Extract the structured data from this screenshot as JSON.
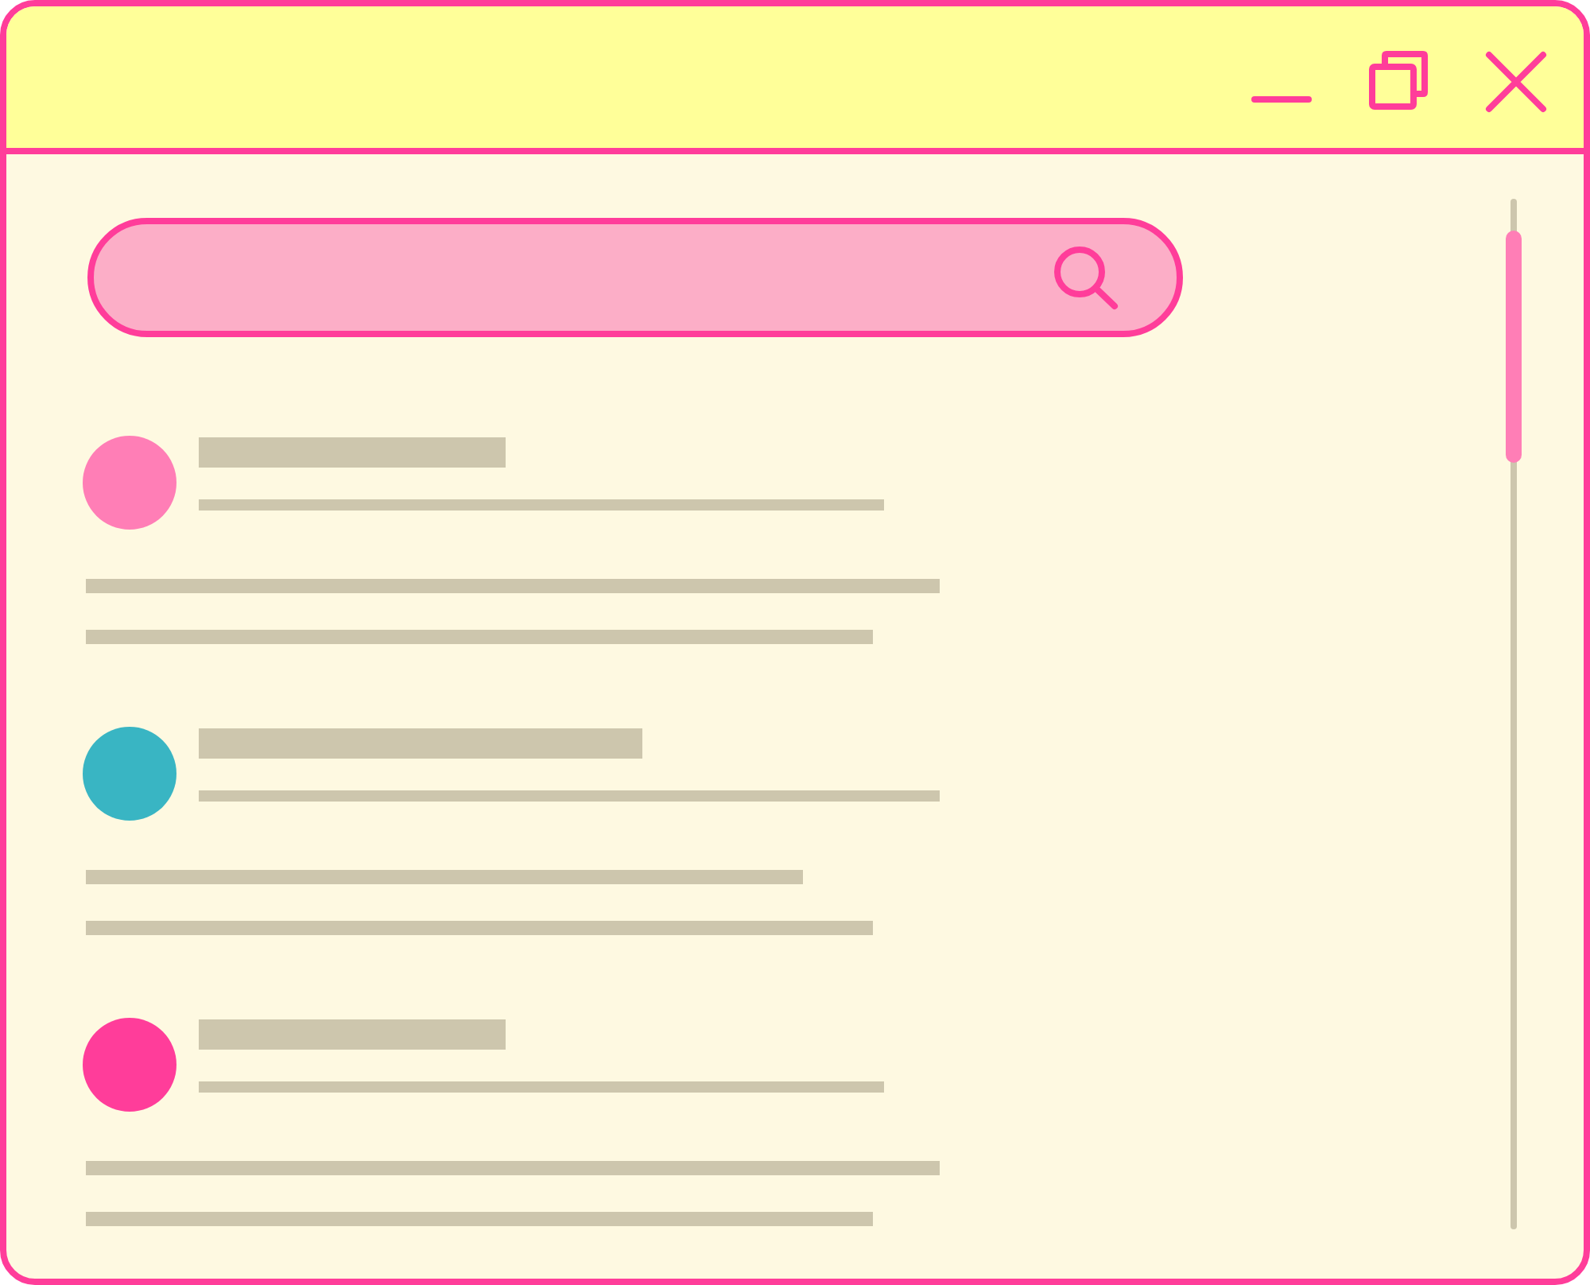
{
  "window": {
    "controls": [
      {
        "kind": "minimize"
      },
      {
        "kind": "restore"
      },
      {
        "kind": "close"
      }
    ]
  },
  "posts": [
    {
      "color": "#ff7eb6"
    },
    {
      "color": "#39b5c3"
    },
    {
      "color": "#ff3d9a"
    }
  ]
}
